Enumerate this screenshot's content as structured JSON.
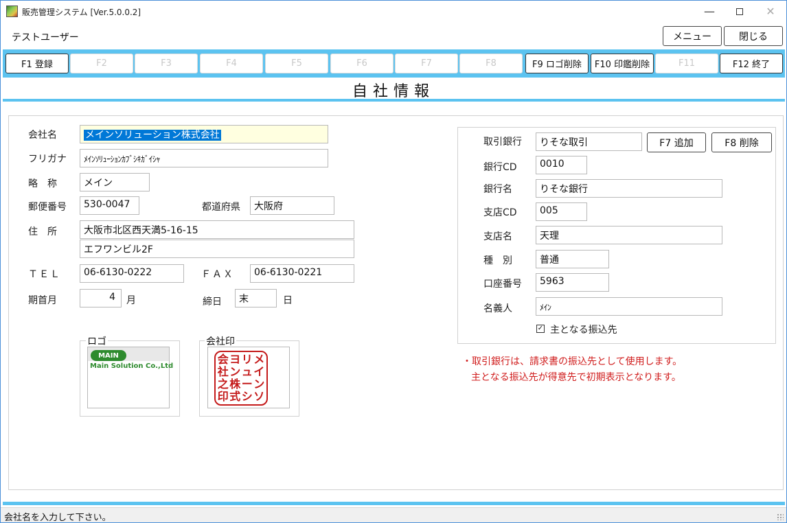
{
  "window": {
    "title": "販売管理システム [Ver.5.0.0.2]",
    "controls": {
      "minimize": "—",
      "close": "✕"
    }
  },
  "header": {
    "user": "テストユーザー",
    "menu_button": "メニュー",
    "close_button": "閉じる"
  },
  "fkeys": [
    {
      "label": "F1 登録",
      "enabled": true
    },
    {
      "label": "F2",
      "enabled": false
    },
    {
      "label": "F3",
      "enabled": false
    },
    {
      "label": "F4",
      "enabled": false
    },
    {
      "label": "F5",
      "enabled": false
    },
    {
      "label": "F6",
      "enabled": false
    },
    {
      "label": "F7",
      "enabled": false
    },
    {
      "label": "F8",
      "enabled": false
    },
    {
      "label": "F9 ロゴ削除",
      "enabled": true
    },
    {
      "label": "F10 印鑑削除",
      "enabled": true
    },
    {
      "label": "F11",
      "enabled": false
    },
    {
      "label": "F12 終了",
      "enabled": true
    }
  ],
  "page_title": "自社情報",
  "company": {
    "name_label": "会社名",
    "name_value": "メインソリューション株式会社",
    "kana_label": "フリガナ",
    "kana_value": "ﾒｲﾝｿﾘｭｰｼｮﾝｶﾌﾞｼｷｶﾞｲｼｬ",
    "short_label": "略　称",
    "short_value": "メイン",
    "zip_label": "郵便番号",
    "zip_value": "530-0047",
    "pref_label": "都道府県",
    "pref_value": "大阪府",
    "address_label": "住　所",
    "address1_value": "大阪市北区西天満5-16-15",
    "address2_value": "エフワンビル2F",
    "tel_label": "ＴＥＬ",
    "tel_value": "06-6130-0222",
    "fax_label": "ＦＡＸ",
    "fax_value": "06-6130-0221",
    "fiscal_label": "期首月",
    "fiscal_value": "4",
    "fiscal_unit": "月",
    "closing_label": "締日",
    "closing_value": "末",
    "closing_unit": "日"
  },
  "logo_group": {
    "label": "ロゴ",
    "logo_mark": "MAIN",
    "logo_text": "Main Solution Co.,Ltd"
  },
  "seal_group": {
    "label": "会社印",
    "seal_chars": [
      "メ",
      "イ",
      "ン",
      "ソ",
      "リ",
      "ュ",
      "ー",
      "シ",
      "ヨ",
      "ン",
      "株",
      "式",
      "会",
      "社",
      "之",
      "印"
    ]
  },
  "bank": {
    "bank_label": "取引銀行",
    "bank_value": "りそな取引",
    "add_button": "F7 追加",
    "delete_button": "F8 削除",
    "bank_cd_label": "銀行CD",
    "bank_cd_value": "0010",
    "bank_name_label": "銀行名",
    "bank_name_value": "りそな銀行",
    "branch_cd_label": "支店CD",
    "branch_cd_value": "005",
    "branch_name_label": "支店名",
    "branch_name_value": "天理",
    "type_label": "種　別",
    "type_value": "普通",
    "account_label": "口座番号",
    "account_value": "5963",
    "holder_label": "名義人",
    "holder_value": "ﾒｲﾝ",
    "primary_label": "主となる振込先",
    "primary_checked": true
  },
  "notes": [
    "・取引銀行は、請求書の振込先として使用します。",
    "主となる振込先が得意先で初期表示となります。"
  ],
  "status": "会社名を入力して下さい。"
}
